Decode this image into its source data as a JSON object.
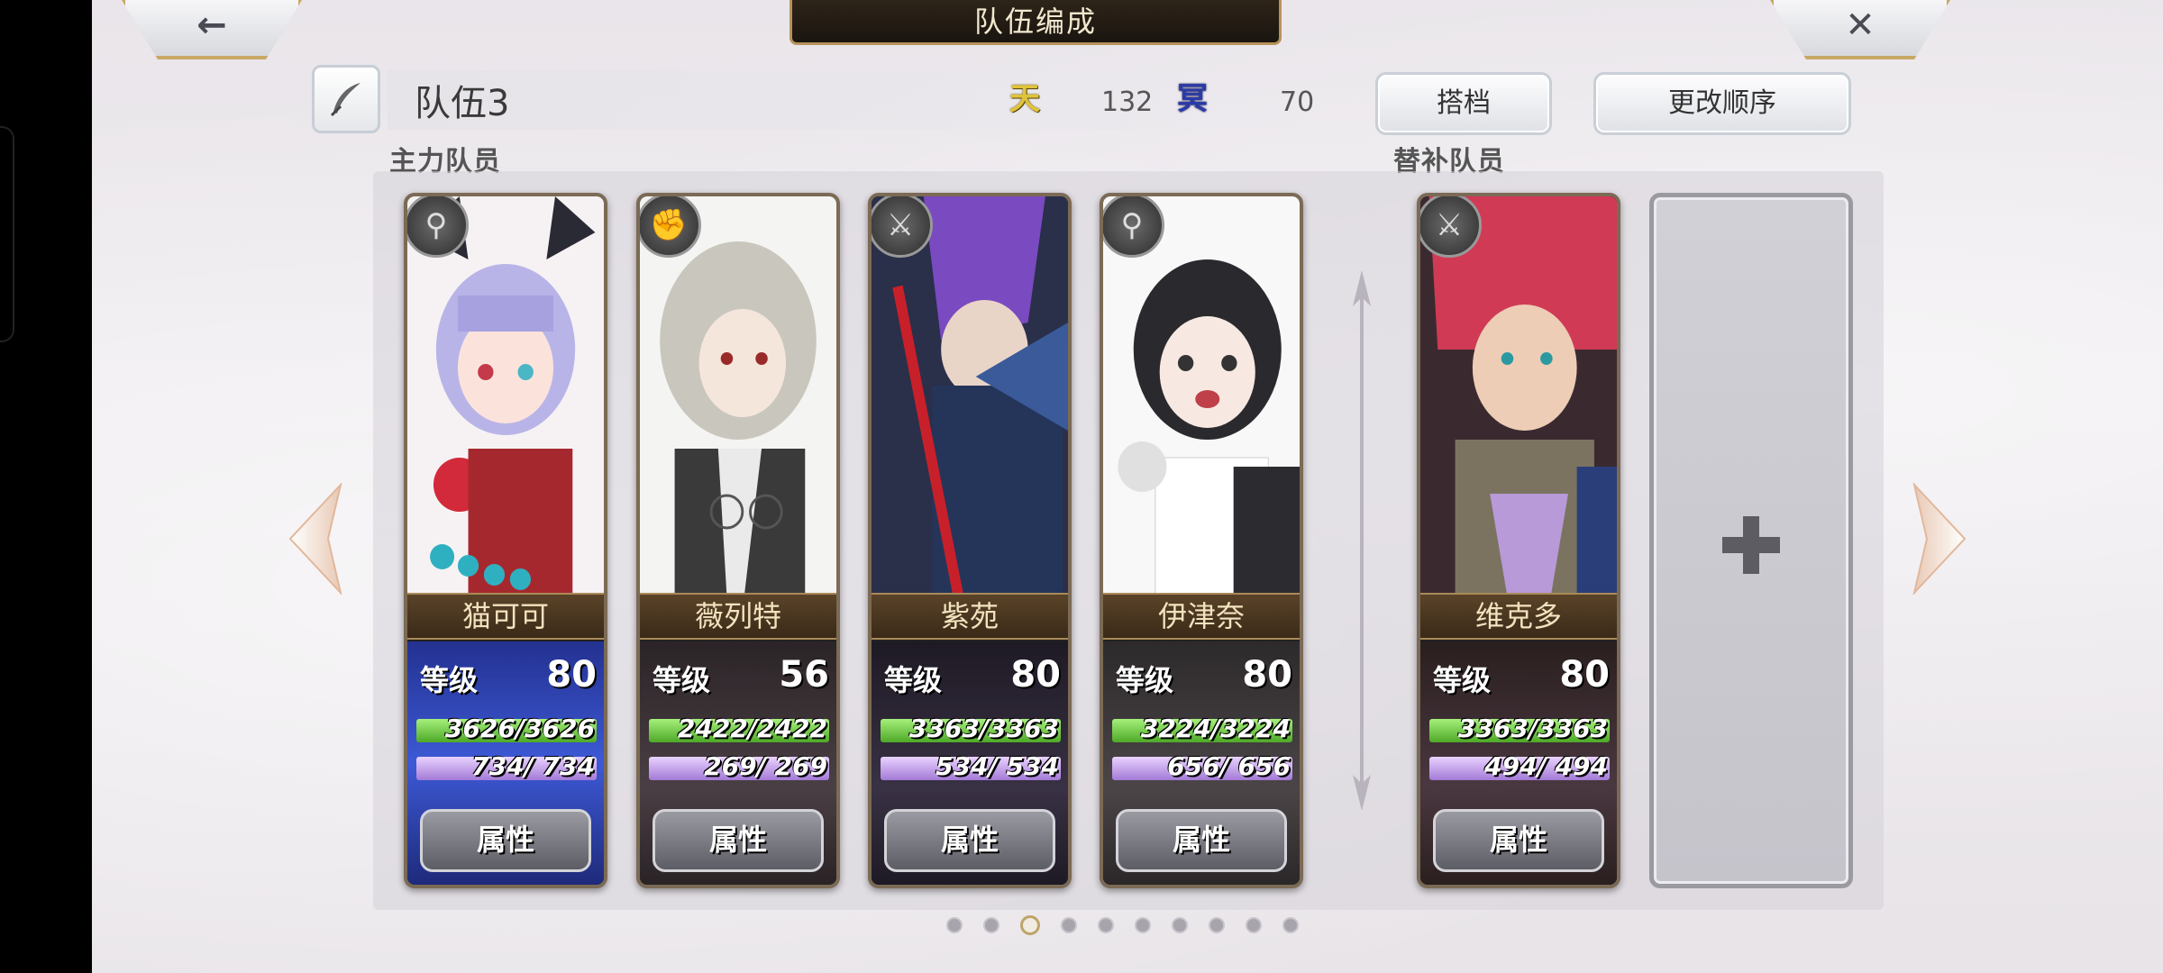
{
  "header": {
    "title": "队伍编成",
    "back_glyph": "←",
    "close_glyph": "✕"
  },
  "team": {
    "name": "队伍3",
    "heaven_icon_text": "天",
    "heaven_value": "132",
    "hell_icon_text": "冥",
    "hell_value": "70"
  },
  "buttons": {
    "partner": "搭档",
    "change_order": "更改顺序"
  },
  "sections": {
    "main": "主力队员",
    "sub": "替补队员"
  },
  "level_label": "等级",
  "attr_label": "属性",
  "members": [
    {
      "name": "猫可可",
      "level": "80",
      "hp": "3626/3626",
      "mp": "734/ 734",
      "class_icon": "staff-icon"
    },
    {
      "name": "薇列特",
      "level": "56",
      "hp": "2422/2422",
      "mp": "269/ 269",
      "class_icon": "fist-icon"
    },
    {
      "name": "紫苑",
      "level": "80",
      "hp": "3363/3363",
      "mp": "534/ 534",
      "class_icon": "sword-icon"
    },
    {
      "name": "伊津奈",
      "level": "80",
      "hp": "3224/3224",
      "mp": "656/ 656",
      "class_icon": "staff-icon"
    },
    {
      "name": "维克多",
      "level": "80",
      "hp": "3363/3363",
      "mp": "494/ 494",
      "class_icon": "sword-icon"
    }
  ],
  "pager": {
    "count": 10,
    "active_index": 2
  },
  "colors": {
    "accent_gold": "#bfa46a",
    "hp_green": "#4ea827",
    "mp_purple": "#a37ad6"
  }
}
